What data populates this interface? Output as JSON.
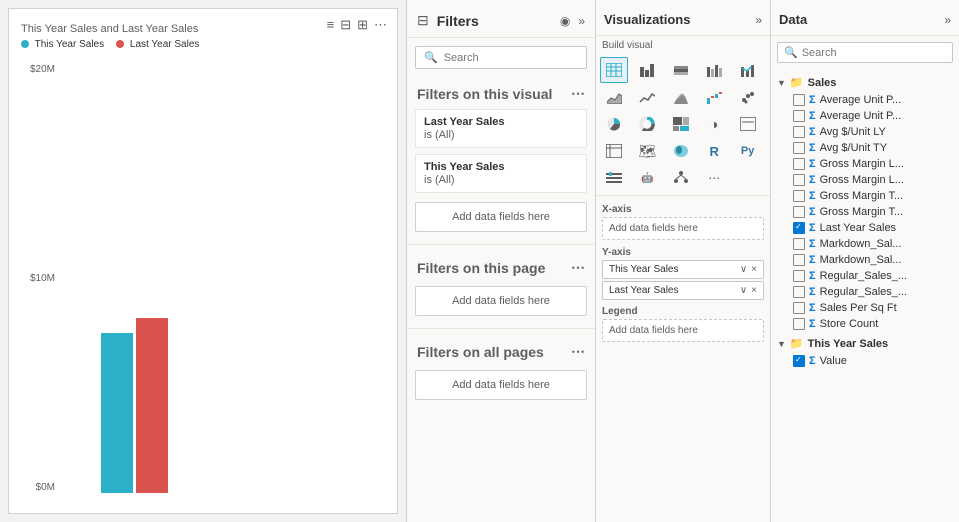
{
  "chart": {
    "title": "This Year Sales and Last Year Sales",
    "legend": [
      {
        "label": "This Year Sales",
        "color": "#2cafc8"
      },
      {
        "label": "Last Year Sales",
        "color": "#d9534f"
      }
    ],
    "yAxis": [
      "$20M",
      "$10M",
      "$0M"
    ],
    "bars": [
      {
        "label": "This Year Sales",
        "color": "#2cafc8",
        "height": 160
      },
      {
        "label": "Last Year Sales",
        "color": "#d9534f",
        "height": 175
      }
    ]
  },
  "filters": {
    "title": "Filters",
    "search_placeholder": "Search",
    "section_visual": "Filters on this visual",
    "section_page": "Filters on this page",
    "section_all": "Filters on all pages",
    "filter_cards": [
      {
        "title": "Last Year Sales",
        "value": "is (All)"
      },
      {
        "title": "This Year Sales",
        "value": "is (All)"
      }
    ],
    "add_data_label": "Add data fields here"
  },
  "visualizations": {
    "title": "Visualizations",
    "expand_label": "»",
    "build_visual_label": "Build visual",
    "fields": {
      "xaxis_label": "X-axis",
      "xaxis_placeholder": "Add data fields here",
      "yaxis_label": "Y-axis",
      "yaxis_pills": [
        "This Year Sales",
        "Last Year Sales"
      ],
      "legend_label": "Legend",
      "legend_placeholder": "Add data fields here"
    }
  },
  "data": {
    "title": "Data",
    "expand_label": "»",
    "search_placeholder": "Search",
    "groups": [
      {
        "name": "Sales",
        "expanded": true,
        "items": [
          {
            "label": "Average Unit P...",
            "checked": false,
            "type": "measure"
          },
          {
            "label": "Average Unit P...",
            "checked": false,
            "type": "measure"
          },
          {
            "label": "Avg $/Unit LY",
            "checked": false,
            "type": "measure"
          },
          {
            "label": "Avg $/Unit TY",
            "checked": false,
            "type": "measure"
          },
          {
            "label": "Gross Margin L...",
            "checked": false,
            "type": "measure"
          },
          {
            "label": "Gross Margin L...",
            "checked": false,
            "type": "measure"
          },
          {
            "label": "Gross Margin T...",
            "checked": false,
            "type": "measure"
          },
          {
            "label": "Gross Margin T...",
            "checked": false,
            "type": "measure"
          },
          {
            "label": "Last Year Sales",
            "checked": true,
            "type": "measure"
          },
          {
            "label": "Markdown_Sal...",
            "checked": false,
            "type": "measure"
          },
          {
            "label": "Markdown_Sal...",
            "checked": false,
            "type": "measure"
          },
          {
            "label": "Regular_Sales_...",
            "checked": false,
            "type": "measure"
          },
          {
            "label": "Regular_Sales_...",
            "checked": false,
            "type": "measure"
          },
          {
            "label": "Sales Per Sq Ft",
            "checked": false,
            "type": "measure"
          },
          {
            "label": "Store Count",
            "checked": false,
            "type": "measure"
          }
        ]
      },
      {
        "name": "This Year Sales",
        "expanded": true,
        "items": [
          {
            "label": "Value",
            "checked": true,
            "type": "measure"
          }
        ]
      }
    ]
  }
}
